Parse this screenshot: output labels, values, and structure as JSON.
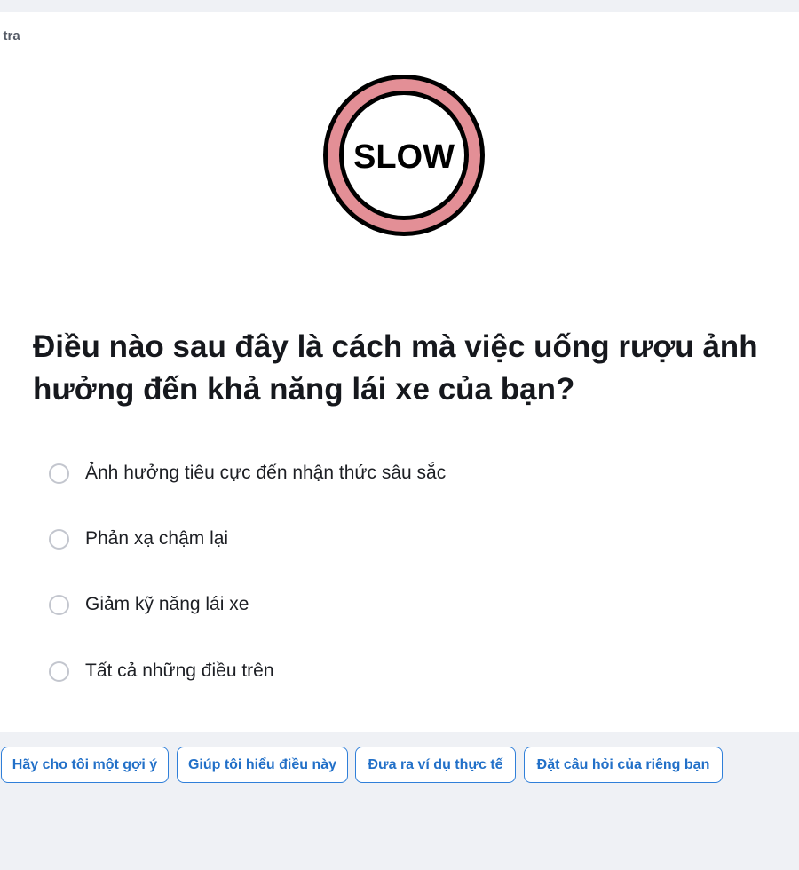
{
  "header": {
    "tag_label": "m tra"
  },
  "image": {
    "sign_text": "SLOW",
    "ring_color": "#e38f96"
  },
  "question": {
    "text": "Điều nào sau đây là cách mà việc uống rượu ảnh hưởng đến khả năng lái xe của bạn?"
  },
  "options": [
    {
      "label": "Ảnh hưởng tiêu cực đến nhận thức sâu sắc"
    },
    {
      "label": "Phản xạ chậm lại"
    },
    {
      "label": "Giảm kỹ năng lái xe"
    },
    {
      "label": "Tất cả những điều trên"
    }
  ],
  "actions": [
    {
      "label": "Hãy cho tôi một gợi ý"
    },
    {
      "label": "Giúp tôi hiểu điều này"
    },
    {
      "label": "Đưa ra ví dụ thực tế"
    },
    {
      "label": "Đặt câu hỏi của riêng bạn"
    }
  ],
  "colors": {
    "accent": "#2f7fd9",
    "background": "#eff1f5"
  }
}
